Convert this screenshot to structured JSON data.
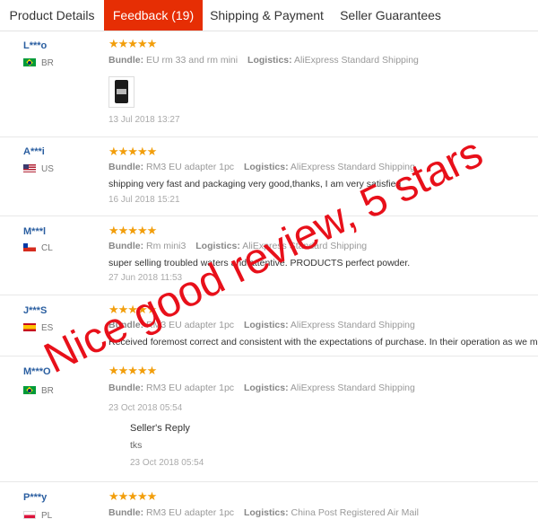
{
  "tabs": [
    {
      "label": "Product Details"
    },
    {
      "label": "Feedback (19)",
      "active": true
    },
    {
      "label": "Shipping & Payment"
    },
    {
      "label": "Seller Guarantees"
    }
  ],
  "labels": {
    "bundle": "Bundle:",
    "logistics": "Logistics:"
  },
  "rating_stars": "★★★★★",
  "reviews": [
    {
      "user": "L***o",
      "country": "BR",
      "bundle": "EU rm 33 and rm mini",
      "logistics": "AliExpress Standard Shipping",
      "has_photo": true,
      "date": "13 Jul 2018 13:27"
    },
    {
      "user": "A***i",
      "country": "US",
      "bundle": "RM3 EU adapter 1pc",
      "logistics": "AliExpress Standard Shipping",
      "text": "shipping very fast and packaging very good,thanks, I am very satisfied",
      "date": "16 Jul 2018 15:21"
    },
    {
      "user": "M***l",
      "country": "CL",
      "bundle": "Rm mini3",
      "logistics": "AliExpress Standard Shipping",
      "text": "super selling troubled waters and attentive. PRODUCTS perfect powder.",
      "date": "27 Jun 2018 11:53"
    },
    {
      "user": "J***S",
      "country": "ES",
      "bundle": "RM3 EU adapter 1pc",
      "logistics": "AliExpress Standard Shipping",
      "text": "Received foremost correct and consistent with the expectations of purchase. In their operation as we must"
    },
    {
      "user": "M***O",
      "country": "BR",
      "bundle": "RM3 EU adapter 1pc",
      "logistics": "AliExpress Standard Shipping",
      "date": "23 Oct 2018 05:54",
      "reply": {
        "title": "Seller's Reply",
        "text": "tks",
        "date": "23 Oct 2018 05:54"
      }
    },
    {
      "user": "P***y",
      "country": "PL",
      "bundle": "RM3 EU adapter 1pc",
      "logistics": "China Post Registered Air Mail"
    }
  ],
  "overlay": {
    "text": "Nice good review, 5 stars",
    "color": "#e8101a"
  },
  "colors": {
    "accent": "#e62e04",
    "star": "#f29e0b",
    "username": "#2a5ea0"
  }
}
